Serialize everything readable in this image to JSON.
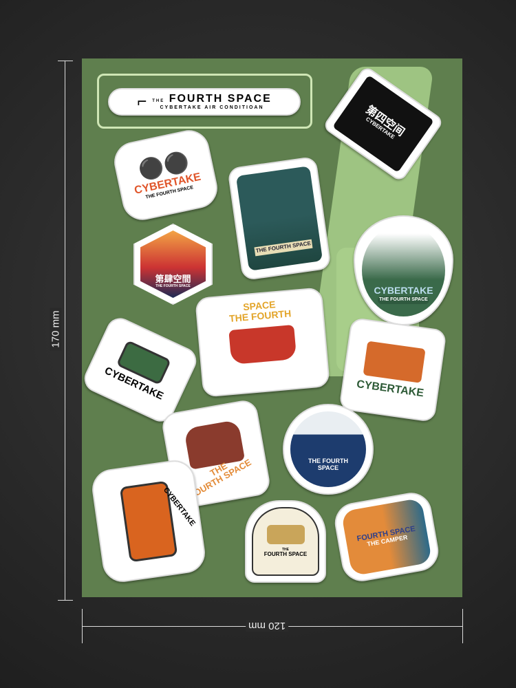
{
  "dimensions": {
    "height_label": "170 mm",
    "width_label": "120 mm"
  },
  "colors": {
    "sheet": "#5f7f4e",
    "accent": "#a9d08c",
    "orange": "#e0552a"
  },
  "stickers": [
    {
      "title": "FOURTH SPACE",
      "pre": "THE",
      "sub": "CYBERTAKE AIR CONDITIOAN"
    },
    {
      "title": "第四空间",
      "sub": "CYBERTAKE"
    },
    {
      "title": "CYBERTAKE",
      "sub": "THE FOURTH SPACE"
    },
    {
      "title": "THE FOURTH SPACE"
    },
    {
      "title": "第肆空間",
      "sub": "THE FOURTH SPACE"
    },
    {
      "title": "CYBERTAKE",
      "sub": "THE FOURTH SPACE"
    },
    {
      "title": "SPACE",
      "sub": "THE FOURTH"
    },
    {
      "title": "CYBERTAKE"
    },
    {
      "title": "CYBERTAKE"
    },
    {
      "title": "THE FOURTH SPACE"
    },
    {
      "title": "THE",
      "sub": "FOURTH SPACE"
    },
    {
      "title": "CYBERTAKE"
    },
    {
      "title": "THE",
      "sub": "FOURTH SPACE"
    },
    {
      "title": "FOURTH SPACE",
      "sub": "THE CAMPER"
    }
  ]
}
